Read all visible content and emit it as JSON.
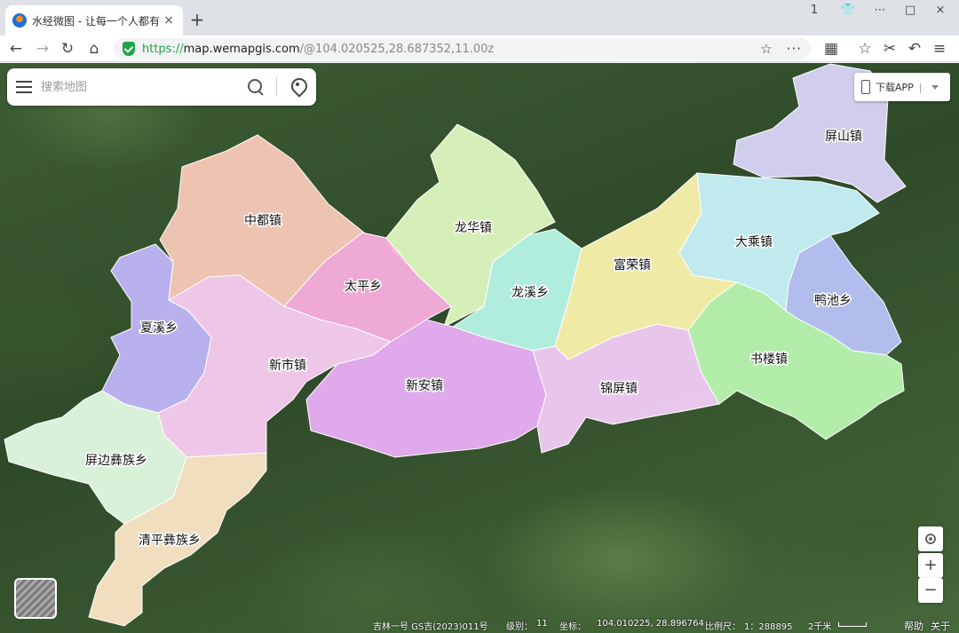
{
  "browser": {
    "tab_title": "水经微图 - 让每一个人都有自",
    "close_glyph": "×",
    "new_tab_glyph": "+",
    "url_scheme": "https://",
    "url_host": "map.wemapgis.com",
    "url_path": "/@104.020525,28.687352,11.00z",
    "window_controls": [
      "1",
      "👕",
      "⋯",
      "□",
      "×"
    ],
    "nav_glyphs": {
      "back": "←",
      "forward": "→",
      "reload": "↻",
      "home": "⌂",
      "star": "☆",
      "more": "···",
      "apps": "▦",
      "fav": "☆",
      "cut": "✂",
      "undo": "↶",
      "menu": "≡"
    }
  },
  "search": {
    "placeholder": "搜索地图"
  },
  "app_download": {
    "label": "下载APP",
    "separator": "|"
  },
  "map_regions": [
    {
      "name": "屏山镇",
      "color": "#d9d5f7"
    },
    {
      "name": "中都镇",
      "color": "#f8c9b8"
    },
    {
      "name": "龙华镇",
      "color": "#dff8c0"
    },
    {
      "name": "太平乡",
      "color": "#f9aede"
    },
    {
      "name": "龙溪乡",
      "color": "#b7f5e6"
    },
    {
      "name": "富荣镇",
      "color": "#fbf2ae"
    },
    {
      "name": "大乘镇",
      "color": "#c8f2f8"
    },
    {
      "name": "鸭池乡",
      "color": "#b9c3f8"
    },
    {
      "name": "夏溪乡",
      "color": "#c0b6f8"
    },
    {
      "name": "新市镇",
      "color": "#f9cdf2"
    },
    {
      "name": "新安镇",
      "color": "#eaaef5"
    },
    {
      "name": "锦屏镇",
      "color": "#f2ccf5"
    },
    {
      "name": "书楼镇",
      "color": "#b8f5b0"
    },
    {
      "name": "屏边彝族乡",
      "color": "#e3f9e3"
    },
    {
      "name": "清平彝族乡",
      "color": "#fce6c7"
    }
  ],
  "controls": {
    "zoom_in": "+",
    "zoom_out": "−"
  },
  "status": {
    "imagery": "吉林一号 GS吉(2023)011号",
    "level_label": "级别：",
    "level": "11",
    "coord_label": "坐标：",
    "coord": "104.010225, 28.896764",
    "scale_label": "比例尺：",
    "scale": "1：288895",
    "scale_bar": "2千米",
    "help": "帮助",
    "about": "关于"
  }
}
